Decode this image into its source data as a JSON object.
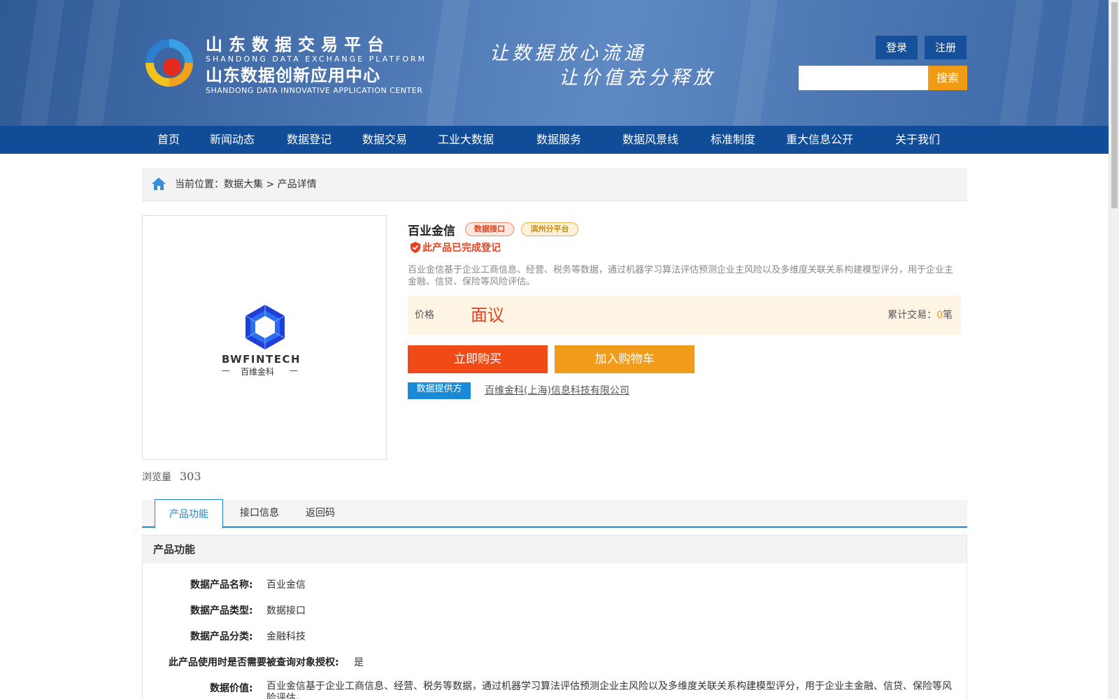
{
  "header": {
    "logo_line1": "山东数据交易平台",
    "logo_line2": "SHANDONG DATA EXCHANGE PLATFORM",
    "logo_line3": "山东数据创新应用中心",
    "logo_line4": "SHANDONG DATA INNOVATIVE APPLICATION CENTER",
    "slogan_line1": "让数据放心流通",
    "slogan_line2": "让价值充分释放",
    "login_label": "登录",
    "register_label": "注册",
    "search_placeholder": "",
    "search_button": "搜索"
  },
  "nav": {
    "items": [
      "首页",
      "新闻动态",
      "数据登记",
      "数据交易",
      "工业大数据",
      "数据服务",
      "数据风景线",
      "标准制度",
      "重大信息公开",
      "关于我们"
    ]
  },
  "breadcrumb": {
    "prefix": "当前位置：",
    "path": [
      "数据大集",
      "产品详情"
    ],
    "separator": " > "
  },
  "product": {
    "image_brand_en": "BWFINTECH",
    "image_brand_cn": "百维金科",
    "views_label": "浏览量",
    "views_count": "303",
    "title": "百业金信",
    "tags": [
      "数据接口",
      "滨州分平台"
    ],
    "registered_text": "此产品已完成登记",
    "description": "百业金信基于企业工商信息、经营、税务等数据，通过机器学习算法评估预测企业主风险以及多维度关联关系构建模型评分，用于企业主金融、信贷、保险等风险评估。",
    "price_label": "价格",
    "price_value": "面议",
    "accumulated_label": "累计交易：",
    "accumulated_count": "0",
    "accumulated_unit": "笔",
    "buy_now": "立即购买",
    "add_to_cart": "加入购物车",
    "provider_label": "数据提供方",
    "provider_name": "百维金科(上海)信息科技有限公司"
  },
  "tabs": [
    "产品功能",
    "接口信息",
    "返回码"
  ],
  "detail": {
    "section_title": "产品功能",
    "rows": [
      {
        "label": "数据产品名称:",
        "value": "百业金信"
      },
      {
        "label": "数据产品类型:",
        "value": "数据接口"
      },
      {
        "label": "数据产品分类:",
        "value": "金融科技"
      },
      {
        "label": "此产品使用时是否需要被查询对象授权:",
        "value": "是"
      },
      {
        "label": "数据价值:",
        "value": "百业金信基于企业工商信息、经营、税务等数据，通过机器学习算法评估预测企业主风险以及多维度关联关系构建模型评分，用于企业主金融、信贷、保险等风险评估。"
      }
    ]
  },
  "colors": {
    "header_blue": "#4a74b0",
    "nav_blue": "#114c98",
    "accent_orange": "#f09b13",
    "buy_red": "#f04a16",
    "link_blue": "#1a8ad6"
  }
}
